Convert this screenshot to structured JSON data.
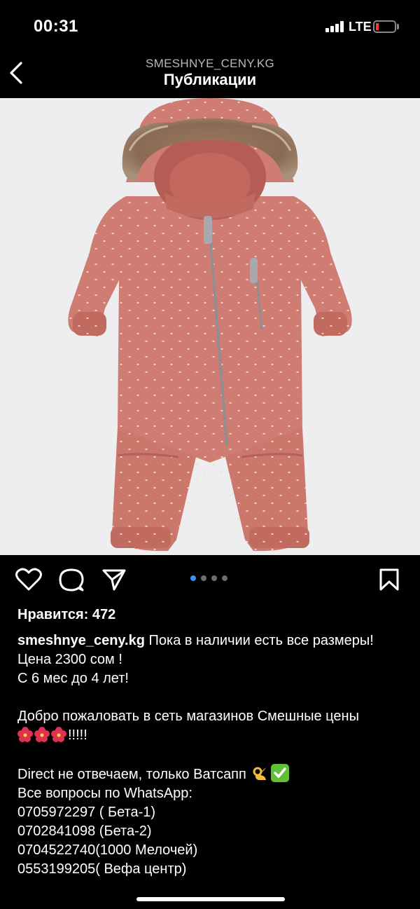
{
  "status_bar": {
    "time": "00:31",
    "network": "LTE",
    "battery_color": "#ff3b30"
  },
  "header": {
    "back_icon": "chevron-left-icon",
    "account": "SMESHNYE_CENY.KG",
    "title": "Публикации"
  },
  "post": {
    "image_subject": "pink-polka-dot-snowsuit-with-fur-hood",
    "carousel": {
      "count": 4,
      "active_index": 0,
      "active_color": "#3797f0"
    },
    "actions": {
      "like_icon": "heart-icon",
      "comment_icon": "comment-icon",
      "share_icon": "send-icon",
      "save_icon": "bookmark-icon"
    },
    "likes": "Нравится: 472",
    "caption": {
      "username": "smeshnye_ceny.kg",
      "first_line": " Пока в наличии есть все размеры!",
      "lines": [
        "Цена 2300 сом !",
        "С 6 мес до 4 лет!",
        "",
        "Добро пожаловать в сеть магазинов Смешные цены"
      ],
      "flowers_suffix": "!!!!!",
      "blank": "",
      "direct_line": "Direct не отвечаем, только Ватсапп",
      "contacts": [
        "Все вопросы по WhatsApp:",
        "0705972297 ( Бета-1)",
        "0702841098 (Бета-2)",
        "0704522740(1000 Мелочей)",
        "0553199205( Вефа центр)"
      ]
    }
  }
}
